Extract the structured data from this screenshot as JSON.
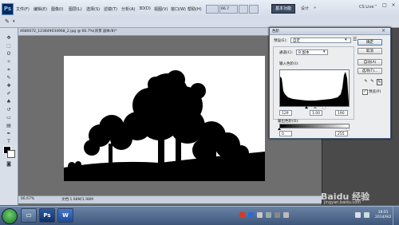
{
  "app": {
    "logo": "Ps"
  },
  "menu": [
    "文件(F)",
    "编辑(E)",
    "图像(I)",
    "图层(L)",
    "选择(S)",
    "滤镜(T)",
    "分析(A)",
    "3D(D)",
    "视图(V)",
    "窗口(W)",
    "帮助(H)"
  ],
  "zoom_box": "66.7",
  "workspace": {
    "active": "基本功能",
    "link": "设计"
  },
  "cs_live": "CS Live",
  "document": {
    "tab_title": "4680072_123849034968_2.jpg @ 66.7%(背景 副本/8)*",
    "zoom": "66.67%",
    "doc_info": "文档:1.98M/1.98M"
  },
  "levels": {
    "title": "色阶",
    "preset_label": "预设(E):",
    "preset_value": "自定",
    "channel_label": "通道(C):",
    "channel_value": "B 副本",
    "input_label": "输入色阶(I):",
    "input_values": [
      "129",
      "1.00",
      "190"
    ],
    "output_label": "输出色阶(O):",
    "output_values": [
      "0",
      "255"
    ],
    "buttons": {
      "ok": "确定",
      "cancel": "取消",
      "auto": "自动(A)",
      "options": "选项(T)..."
    },
    "preview_label": "预览(P)"
  },
  "taskbar": {
    "ps_label": "Ps",
    "word_label": "W",
    "time": "18:01",
    "date": "2014/9/2"
  },
  "watermark": {
    "main": "Baidu 经验",
    "sub": "jingyan.baidu.com"
  }
}
